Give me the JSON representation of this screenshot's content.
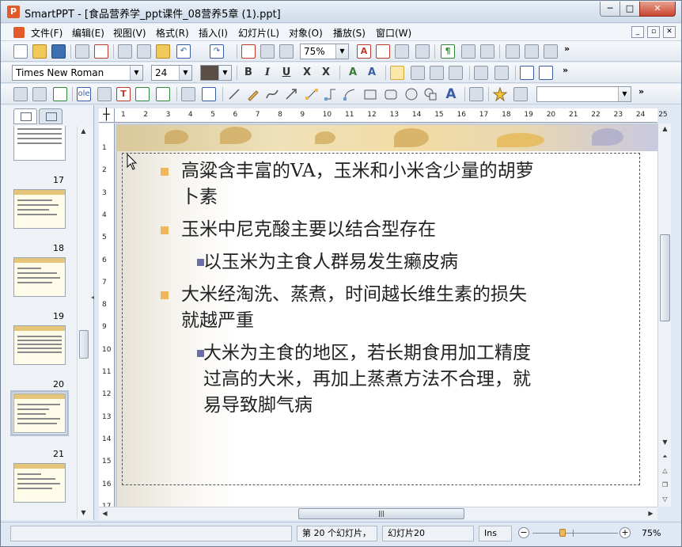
{
  "window": {
    "app_title": "SmartPPT - [食品营养学_ppt课件_08营养5章 (1).ppt]",
    "app_icon_letter": "P",
    "min_label": "─",
    "max_label": "□",
    "close_label": "✕"
  },
  "menubar": {
    "items": [
      "文件(F)",
      "编辑(E)",
      "视图(V)",
      "格式(R)",
      "插入(I)",
      "幻灯片(L)",
      "对象(O)",
      "播放(S)",
      "窗口(W)"
    ],
    "mdi_min": "_",
    "mdi_restore": "▫",
    "mdi_close": "✕"
  },
  "toolbar": {
    "zoom_value": "75%",
    "font_name": "Times New Roman",
    "font_size": "24",
    "more": "»",
    "bold": "B",
    "italic": "I",
    "underline": "U",
    "strike": "X",
    "shadow": "X",
    "grow_font": "A",
    "shrink_font": "A",
    "shape_text": "A",
    "object_combo_value": ""
  },
  "thumbnails": {
    "slides": [
      {
        "number": "17"
      },
      {
        "number": "18"
      },
      {
        "number": "19"
      },
      {
        "number": "20"
      },
      {
        "number": "21"
      }
    ],
    "selected": "20"
  },
  "ruler": {
    "h_ticks": [
      "1",
      "2",
      "3",
      "4",
      "5",
      "6",
      "7",
      "8",
      "9",
      "10",
      "11",
      "12",
      "13",
      "14",
      "15",
      "16",
      "17",
      "18",
      "19",
      "20",
      "21",
      "22",
      "23",
      "24",
      "25"
    ],
    "v_ticks": [
      "1",
      "2",
      "3",
      "4",
      "5",
      "6",
      "7",
      "8",
      "9",
      "10",
      "11",
      "12",
      "13",
      "14",
      "15",
      "16",
      "17"
    ],
    "corner": "┼"
  },
  "slide": {
    "bullets": [
      {
        "level": 1,
        "lines": [
          "高粱含丰富的VA，玉米和小米含少量的胡萝",
          "卜素"
        ]
      },
      {
        "level": 1,
        "lines": [
          "玉米中尼克酸主要以结合型存在"
        ]
      },
      {
        "level": 2,
        "lines": [
          "以玉米为主食人群易发生癞皮病"
        ]
      },
      {
        "level": 1,
        "lines": [
          "大米经淘洗、蒸煮，时间越长维生素的损失",
          "就越严重"
        ]
      },
      {
        "level": 2,
        "lines": [
          "大米为主食的地区，若长期食用加工精度",
          "过高的大米，再加上蒸煮方法不合理，就",
          "易导致脚气病"
        ]
      }
    ]
  },
  "statusbar": {
    "slide_of": "第 20 个幻灯片，",
    "slide_name": "幻灯片20",
    "mode": "Ins",
    "zoom_out": "−",
    "zoom_in": "+",
    "zoom": "75%"
  }
}
